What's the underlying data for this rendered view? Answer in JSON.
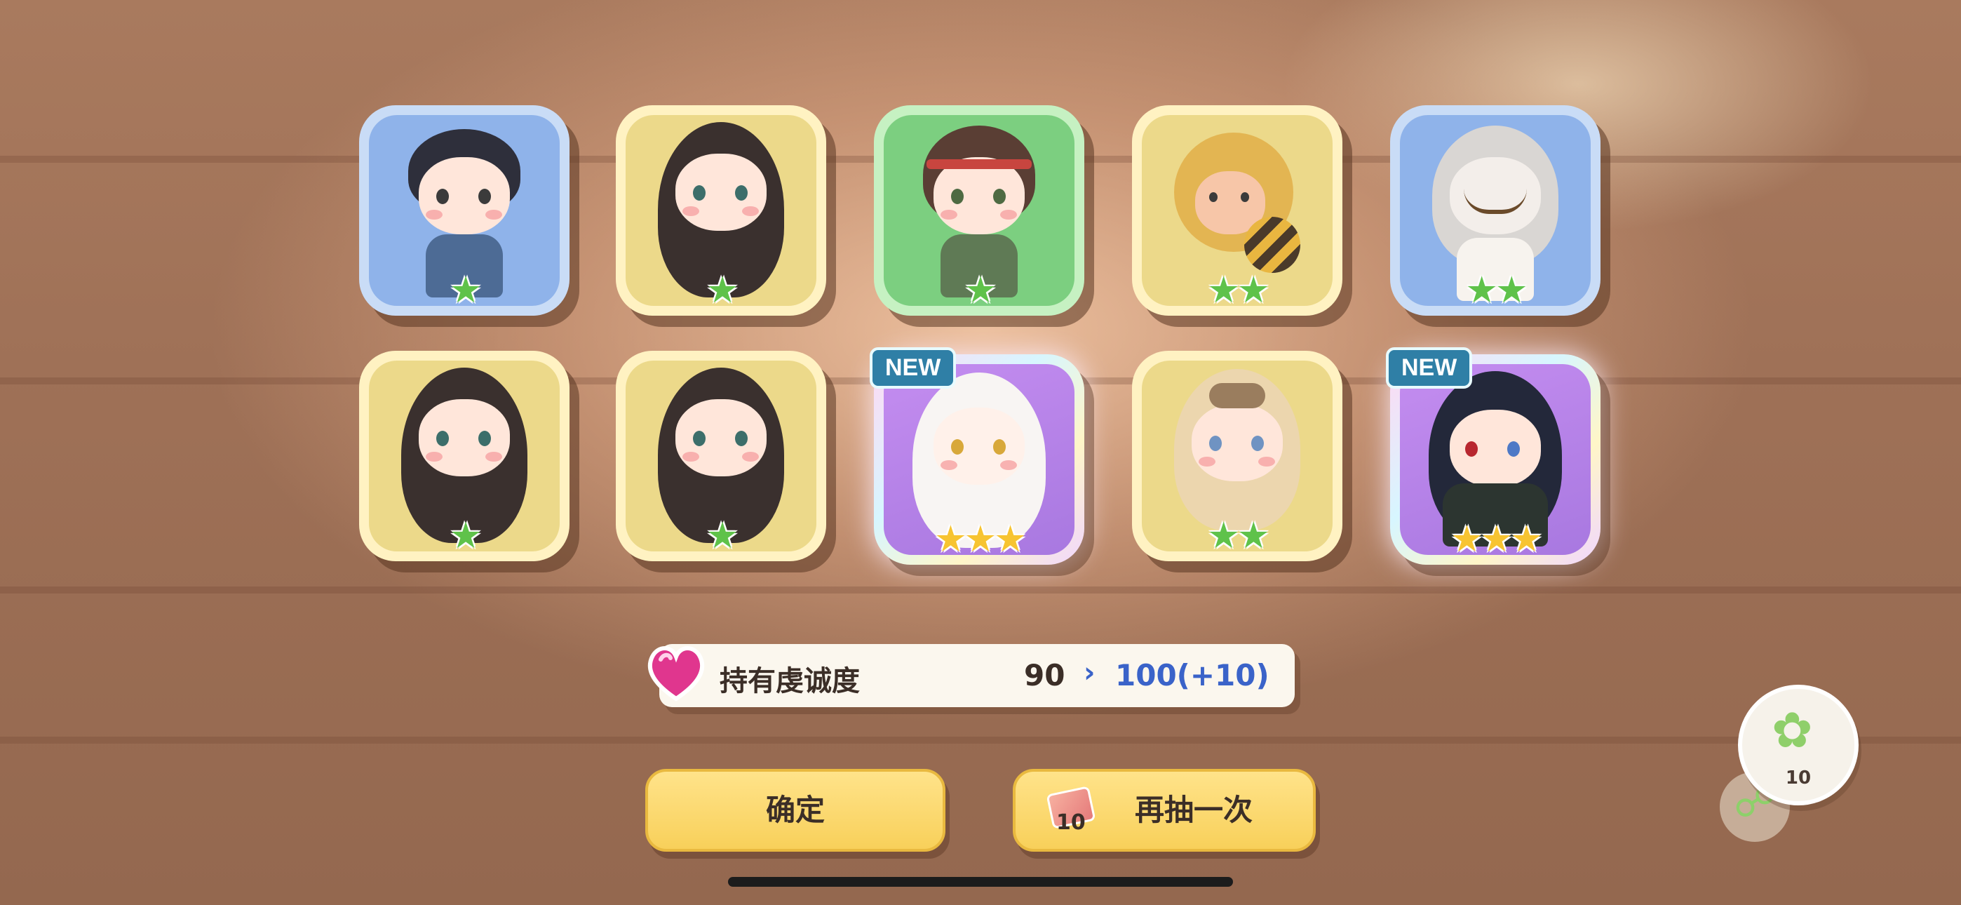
{
  "cards": [
    {
      "frame": "blue",
      "stars": "★",
      "star_color": "green",
      "new": ""
    },
    {
      "frame": "yellow",
      "stars": "★",
      "star_color": "green",
      "new": ""
    },
    {
      "frame": "green",
      "stars": "★",
      "star_color": "green",
      "new": ""
    },
    {
      "frame": "yellow",
      "stars": "★★",
      "star_color": "green",
      "new": ""
    },
    {
      "frame": "blue",
      "stars": "★★",
      "star_color": "green",
      "new": ""
    },
    {
      "frame": "yellow",
      "stars": "★",
      "star_color": "green",
      "new": ""
    },
    {
      "frame": "yellow",
      "stars": "★",
      "star_color": "green",
      "new": ""
    },
    {
      "frame": "rainbow",
      "stars": "★★★",
      "star_color": "gold",
      "new": "NEW"
    },
    {
      "frame": "yellow",
      "stars": "★★",
      "star_color": "green",
      "new": ""
    },
    {
      "frame": "rainbow",
      "stars": "★★★",
      "star_color": "gold",
      "new": "NEW"
    }
  ],
  "devotion": {
    "label": "持有虔诚度",
    "current": "90",
    "arrow": "›",
    "next": "100(+10)"
  },
  "buttons": {
    "confirm": "确定",
    "again": "再抽一次",
    "ticket_count": "10"
  },
  "side": {
    "leaf_count": "10",
    "leaf_icon": "✿",
    "network_icon": "☍"
  },
  "colors": {
    "accent_blue": "#3a63c9",
    "button_yellow": "#f8d05a",
    "new_badge": "#2f7fa6"
  }
}
